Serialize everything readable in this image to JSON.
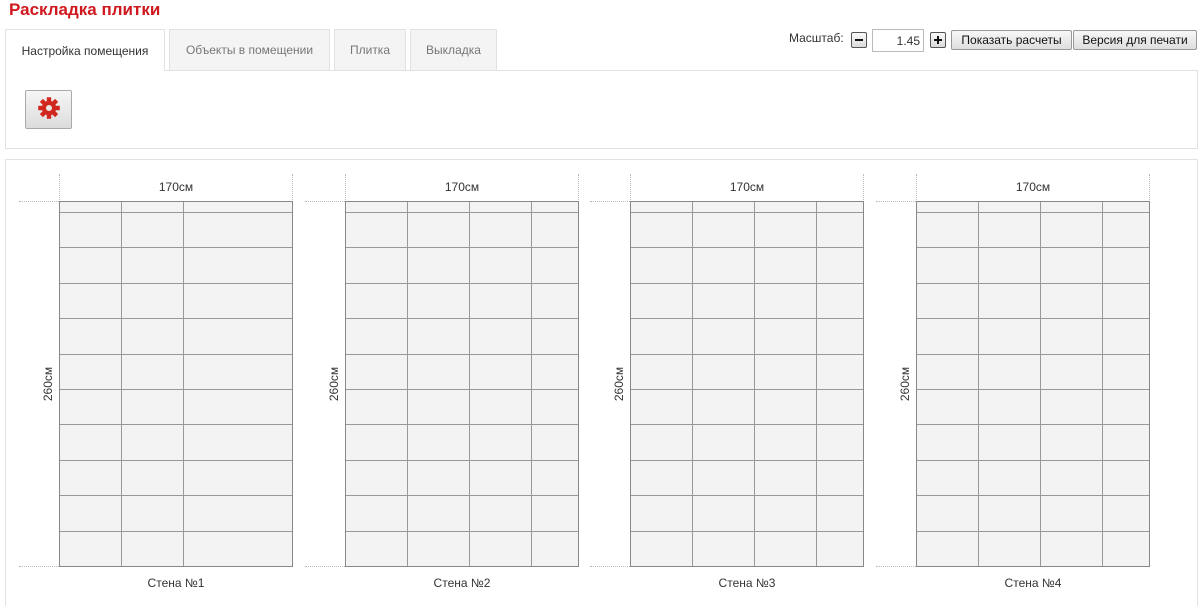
{
  "app": {
    "title": "Раскладка плитки"
  },
  "tabs": [
    {
      "label": "Настройка помещения",
      "active": true
    },
    {
      "label": "Объекты в помещении",
      "active": false
    },
    {
      "label": "Плитка",
      "active": false
    },
    {
      "label": "Выкладка",
      "active": false
    }
  ],
  "settings": {
    "gear_icon": "gear-icon",
    "accent_color": "#d0281f"
  },
  "toolbar": {
    "scale_label": "Масштаб:",
    "scale_value": "1.45",
    "minus_icon": "minus-icon",
    "plus_icon": "plus-icon",
    "show_calc_label": "Показать расчеты",
    "print_label": "Версия для печати"
  },
  "walls": [
    {
      "width_label": "170см",
      "height_label": "260см",
      "caption": "Стена №1",
      "tile_columns": 3,
      "tile_rows": 10
    },
    {
      "width_label": "170см",
      "height_label": "260см",
      "caption": "Стена №2",
      "tile_columns": 4,
      "tile_rows": 10
    },
    {
      "width_label": "170см",
      "height_label": "260см",
      "caption": "Стена №3",
      "tile_columns": 4,
      "tile_rows": 10
    },
    {
      "width_label": "170см",
      "height_label": "260см",
      "caption": "Стена №4",
      "tile_columns": 4,
      "tile_rows": 10
    }
  ]
}
